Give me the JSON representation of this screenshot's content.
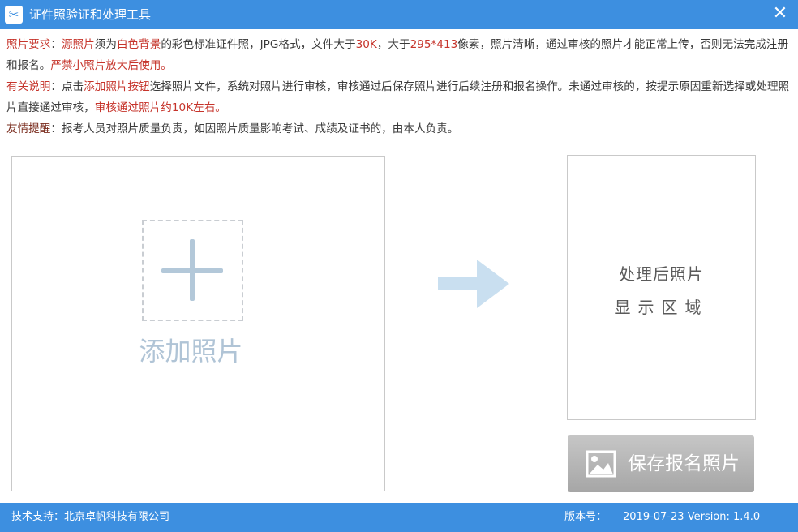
{
  "window": {
    "title": "证件照验证和处理工具",
    "app_icon": "scissors-icon",
    "close_glyph": "✕"
  },
  "notes": {
    "requirement": {
      "label": "照片要求",
      "sep": "：",
      "t1": "源照片",
      "t2": "须为",
      "t3": "白色背景",
      "t4": "的彩色标准证件照，JPG格式，文件大于",
      "t5": "30K",
      "t6": "，大于",
      "t7": "295*413",
      "t8": "像素，照片清晰，通过审核的照片才能正常上传，否则无法完成注册和报名。",
      "t9": "严禁小照片放大后使用。"
    },
    "explanation": {
      "label": "有关说明",
      "sep": "：",
      "t1": "点击",
      "t2": "添加照片按钮",
      "t3": "选择照片文件，系统对照片进行审核，审核通过后保存照片进行后续注册和报名操作。未通过审核的，按提示原因重新选择或处理照片直接通过审核，",
      "t4": "审核通过照片约10K左右。"
    },
    "reminder": {
      "label": "友情提醒",
      "sep": "：",
      "t1": "报考人员对照片质量负责，如因照片质量影响考试、成绩及证书的，由本人负责。"
    }
  },
  "upload": {
    "label": "添加照片",
    "icon": "plus-icon"
  },
  "arrow_icon": "arrow-right-icon",
  "result": {
    "line1": "处理后照片",
    "line2": "显示区域"
  },
  "save_button": {
    "label": "保存报名照片",
    "icon": "image-icon"
  },
  "status": {
    "support": "技术支持：北京卓帆科技有限公司",
    "version_label": "版本号：",
    "version_value": "2019-07-23 Version: 1.4.0"
  },
  "colors": {
    "titlebar": "#3d8fe0",
    "highlight": "#c6342b",
    "accent_light": "#b3c8d9",
    "button": "#b4b4b4"
  }
}
